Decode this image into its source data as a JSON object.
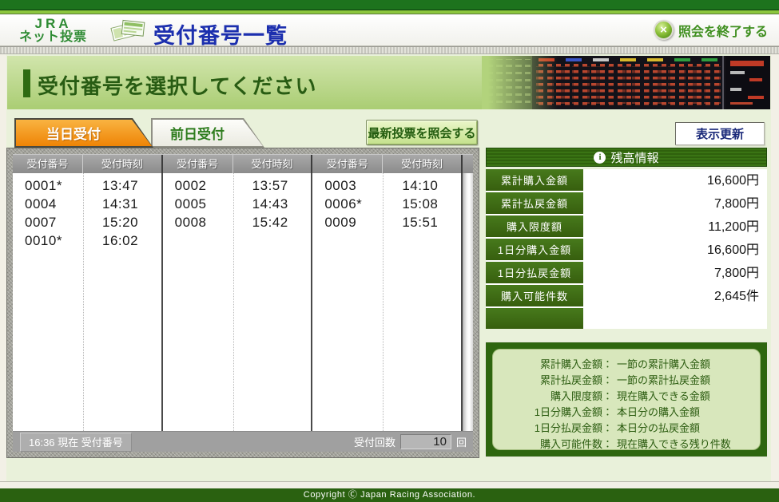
{
  "header": {
    "logo_top": "JRA",
    "logo_bottom": "ネット投票",
    "title": "受付番号一覧",
    "close_label": "照会を終了する"
  },
  "icons": {
    "close_x": "×",
    "info": "i",
    "betting_slips": "betting-slips-icon",
    "tote_board_photo": "tote-board-photo"
  },
  "main": {
    "heading": "受付番号を選択してください"
  },
  "tabs": {
    "today": "当日受付",
    "previous": "前日受付"
  },
  "actions": {
    "latest": "最新投票を照会する",
    "refresh": "表示更新"
  },
  "reception": {
    "headers": [
      "受付番号",
      "受付時刻",
      "受付番号",
      "受付時刻",
      "受付番号",
      "受付時刻"
    ],
    "groups": [
      {
        "rows": [
          {
            "no": "0001*",
            "time": "13:47"
          },
          {
            "no": "0004",
            "time": "14:31"
          },
          {
            "no": "0007",
            "time": "15:20"
          },
          {
            "no": "0010*",
            "time": "16:02"
          }
        ]
      },
      {
        "rows": [
          {
            "no": "0002",
            "time": "13:57"
          },
          {
            "no": "0005",
            "time": "14:43"
          },
          {
            "no": "0008",
            "time": "15:42"
          }
        ]
      },
      {
        "rows": [
          {
            "no": "0003",
            "time": "14:10"
          },
          {
            "no": "0006*",
            "time": "15:08"
          },
          {
            "no": "0009",
            "time": "15:51"
          }
        ]
      }
    ],
    "status": "16:36 現在 受付番号",
    "count_label": "受付回数",
    "count_value": "10",
    "count_unit": "回"
  },
  "balance": {
    "title": "残高情報",
    "rows": [
      {
        "label": "累計購入金額",
        "value": "16,600円"
      },
      {
        "label": "累計払戻金額",
        "value": "7,800円"
      },
      {
        "label": "購入限度額",
        "value": "11,200円"
      },
      {
        "label": "1日分購入金額",
        "value": "16,600円"
      },
      {
        "label": "1日分払戻金額",
        "value": "7,800円"
      },
      {
        "label": "購入可能件数",
        "value": "2,645件"
      }
    ],
    "notes": [
      {
        "label": "累計購入金額：",
        "desc": "一節の累計購入金額"
      },
      {
        "label": "累計払戻金額：",
        "desc": "一節の累計払戻金額"
      },
      {
        "label": "購入限度額：",
        "desc": "現在購入できる金額"
      },
      {
        "label": "1日分購入金額：",
        "desc": "本日分の購入金額"
      },
      {
        "label": "1日分払戻金額：",
        "desc": "本日分の払戻金額"
      },
      {
        "label": "購入可能件数：",
        "desc": "現在購入できる残り件数"
      }
    ]
  },
  "footer": {
    "copyright": "Copyright Ⓒ Japan Racing Association."
  },
  "colors": {
    "brand_green_dark": "#2e6b12",
    "accent_light_green": "#8cc63e",
    "active_tab_orange": "#f08300",
    "title_blue": "#1c2fae",
    "panel_gray": "#a1a199"
  }
}
